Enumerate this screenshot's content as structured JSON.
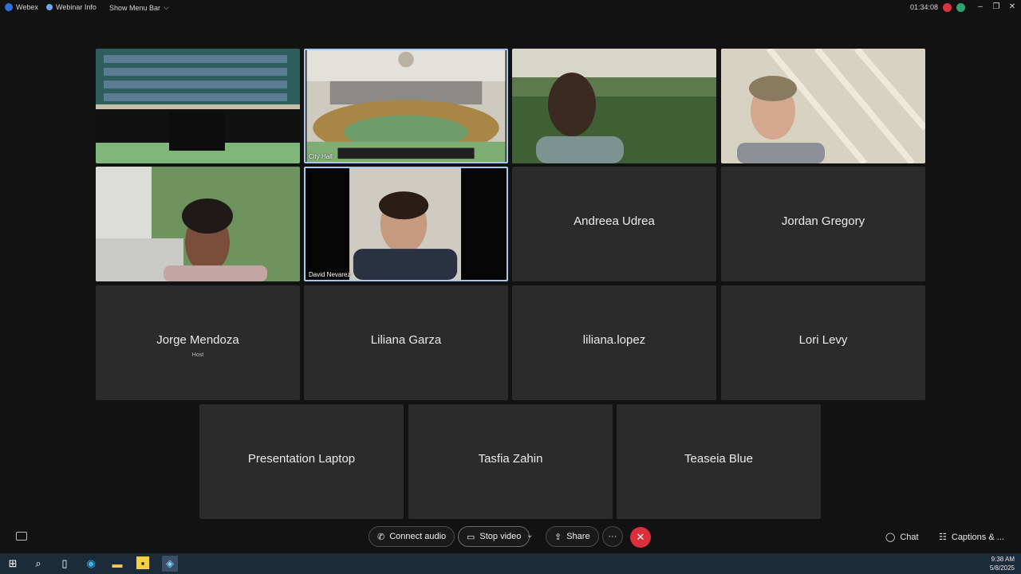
{
  "topbar": {
    "app_label": "Webex",
    "webinar_info_label": "Webinar Info",
    "show_menu_label": "Show Menu Bar",
    "timer": "01:34:08"
  },
  "tiles": {
    "chamber_empty": {
      "caption": ""
    },
    "city_hall": {
      "caption": "City Hall"
    },
    "david": {
      "caption": "David Nevarez"
    },
    "andreea": {
      "name": "Andreea Udrea"
    },
    "jordan": {
      "name": "Jordan Gregory"
    },
    "jorge": {
      "name": "Jorge Mendoza",
      "role": "Host"
    },
    "liliana_garza": {
      "name": "Liliana Garza"
    },
    "liliana_lopez": {
      "name": "liliana.lopez"
    },
    "lori": {
      "name": "Lori Levy"
    },
    "presentation": {
      "name": "Presentation Laptop"
    },
    "tasfia": {
      "name": "Tasfia Zahin"
    },
    "teaseia": {
      "name": "Teaseia Blue"
    }
  },
  "controls": {
    "connect_audio": "Connect audio",
    "stop_video": "Stop video",
    "share": "Share",
    "more": "···",
    "end": "✕",
    "chat": "Chat",
    "captions": "Captions & ..."
  },
  "taskbar": {
    "time": "9:38 AM",
    "date": "5/8/2025"
  },
  "colors": {
    "background": "#121212",
    "tile": "#2b2b2b",
    "active_border": "#a9c7ea",
    "end_button": "#d9303c",
    "taskbar": "#1c2b3a"
  }
}
